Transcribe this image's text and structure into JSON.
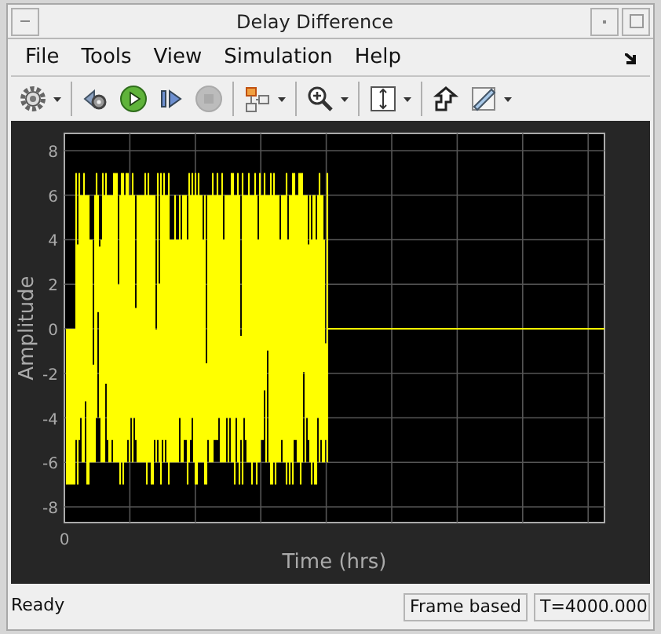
{
  "window": {
    "title": "Delay Difference"
  },
  "menu": [
    {
      "label": "File"
    },
    {
      "label": "Tools"
    },
    {
      "label": "View"
    },
    {
      "label": "Simulation"
    },
    {
      "label": "Help"
    }
  ],
  "toolbar": [
    [
      {
        "kind": "gear",
        "dropdown": true,
        "disabled": false
      }
    ],
    [
      {
        "kind": "sim-settings",
        "dropdown": false,
        "disabled": false
      },
      {
        "kind": "run",
        "dropdown": false,
        "disabled": false
      },
      {
        "kind": "step",
        "dropdown": false,
        "disabled": false
      },
      {
        "kind": "stop",
        "dropdown": false,
        "disabled": true
      }
    ],
    [
      {
        "kind": "highlight",
        "dropdown": true,
        "disabled": false
      }
    ],
    [
      {
        "kind": "zoom",
        "dropdown": true,
        "disabled": false
      }
    ],
    [
      {
        "kind": "scale",
        "dropdown": true,
        "disabled": false
      }
    ],
    [
      {
        "kind": "style",
        "dropdown": false,
        "disabled": false
      },
      {
        "kind": "measure",
        "dropdown": true,
        "disabled": false
      }
    ]
  ],
  "plot": {
    "ylabel": "Amplitude",
    "xlabel": "Time (hrs)",
    "yticks": [
      "8",
      "6",
      "4",
      "2",
      "0",
      "-2",
      "-4",
      "-6",
      "-8"
    ],
    "xticks": [
      "0"
    ]
  },
  "status_bar": {
    "message": "Ready",
    "mode": "Frame based",
    "time": "T=4000.000"
  }
}
